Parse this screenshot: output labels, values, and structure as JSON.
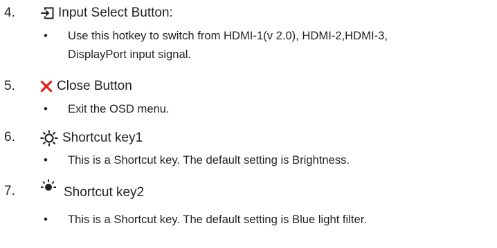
{
  "items": [
    {
      "number": "4.",
      "icon": "input-select-icon",
      "title": "Input Select Button:",
      "bullets": [
        [
          "Use this hotkey to switch from HDMI-1(v 2.0), HDMI-2,HDMI-3,",
          "DisplayPort input signal."
        ]
      ]
    },
    {
      "number": "5.",
      "icon": "close-x-icon",
      "title": "Close Button",
      "bullets": [
        [
          "Exit the OSD menu."
        ]
      ]
    },
    {
      "number": "6.",
      "icon": "sun-outline-icon",
      "title": "Shortcut key1",
      "bullets": [
        [
          "This is a Shortcut key. The default setting is Brightness."
        ]
      ]
    },
    {
      "number": "7.",
      "icon": "sun-filled-icon",
      "title": "Shortcut key2",
      "bullets": [
        [
          "This is a Shortcut key. The default setting is Blue light filter."
        ]
      ]
    }
  ],
  "bullet_symbol": "•",
  "colors": {
    "text": "#231f20",
    "close_icon": "#e2231a"
  }
}
